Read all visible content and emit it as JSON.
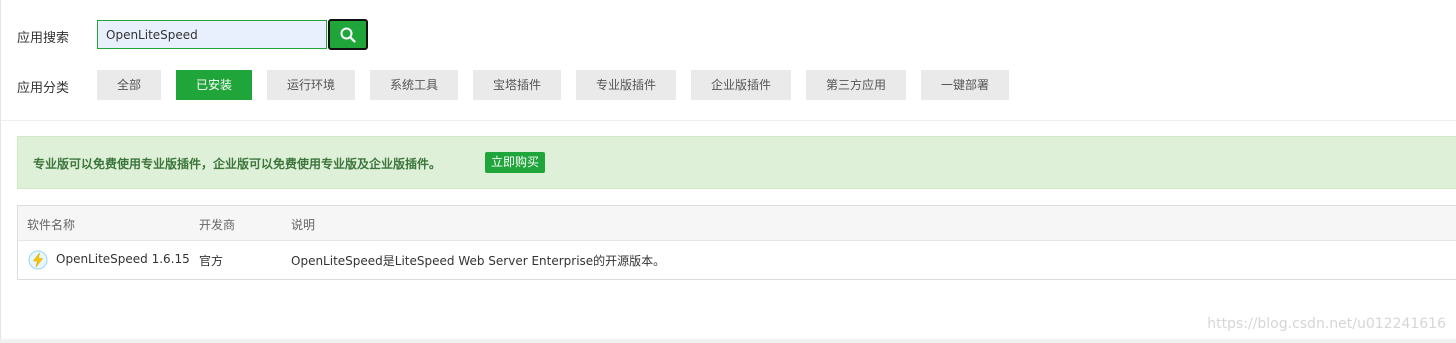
{
  "search": {
    "label": "应用搜索",
    "value": "OpenLiteSpeed",
    "button_icon": "search-icon"
  },
  "categories": {
    "label": "应用分类",
    "items": [
      {
        "label": "全部",
        "active": false
      },
      {
        "label": "已安装",
        "active": true
      },
      {
        "label": "运行环境",
        "active": false
      },
      {
        "label": "系统工具",
        "active": false
      },
      {
        "label": "宝塔插件",
        "active": false
      },
      {
        "label": "专业版插件",
        "active": false
      },
      {
        "label": "企业版插件",
        "active": false
      },
      {
        "label": "第三方应用",
        "active": false
      },
      {
        "label": "一键部署",
        "active": false
      }
    ]
  },
  "banner": {
    "text": "专业版可以免费使用专业版插件，企业版可以免费使用专业版及企业版插件。",
    "button": "立即购买"
  },
  "table": {
    "headers": [
      "软件名称",
      "开发商",
      "说明"
    ],
    "rows": [
      {
        "icon": "lightning-icon",
        "name": "OpenLiteSpeed 1.6.15",
        "developer": "官方",
        "description": "OpenLiteSpeed是LiteSpeed Web Server Enterprise的开源版本。"
      }
    ]
  },
  "watermark": "https://blog.csdn.net/u012241616",
  "colors": {
    "accent": "#20a53a",
    "banner_bg": "#dff0d8",
    "banner_text": "#3c763d"
  }
}
